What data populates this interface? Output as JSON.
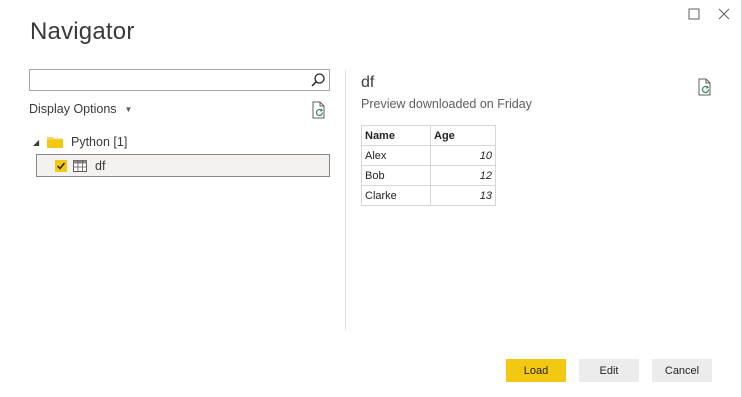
{
  "window": {
    "title": "Navigator"
  },
  "left_pane": {
    "search": {
      "value": "",
      "placeholder": ""
    },
    "display_options_label": "Display Options",
    "tree": {
      "root": {
        "label": "Python [1]",
        "expanded": true
      },
      "items": [
        {
          "label": "df",
          "checked": true,
          "selected": true
        }
      ]
    }
  },
  "preview": {
    "name": "df",
    "subtitle": "Preview downloaded on Friday",
    "columns": [
      "Name",
      "Age"
    ],
    "rows": [
      {
        "name": "Alex",
        "age": "10"
      },
      {
        "name": "Bob",
        "age": "12"
      },
      {
        "name": "Clarke",
        "age": "13"
      }
    ]
  },
  "footer": {
    "load_label": "Load",
    "edit_label": "Edit",
    "cancel_label": "Cancel"
  },
  "colors": {
    "accent": "#F2C811",
    "secondary_button": "#ECECEC",
    "folder": "#F5D36B"
  }
}
